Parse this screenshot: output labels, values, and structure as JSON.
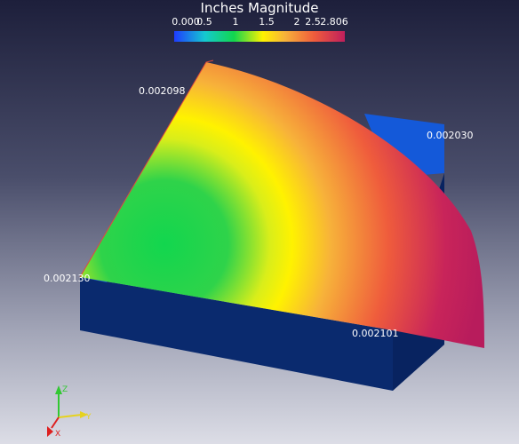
{
  "legend": {
    "title": "Inches Magnitude",
    "ticks": [
      "0.000",
      "0.5",
      "1",
      "1.5",
      "2",
      "2.5",
      "2.806"
    ],
    "colors": [
      "#1e3cff",
      "#15c9d0",
      "#12d64e",
      "#fff200",
      "#f7b23a",
      "#ef5c3c",
      "#c01f5c"
    ]
  },
  "point_labels": [
    "0.002098",
    "0.002030",
    "0.002130",
    "0.002101"
  ],
  "axes": {
    "x": "X",
    "y": "Y",
    "z": "Z"
  },
  "colors": {
    "block_dark": "#0a2a6e",
    "block_top": "#1459d9",
    "gradient_center": "#12d64e"
  }
}
